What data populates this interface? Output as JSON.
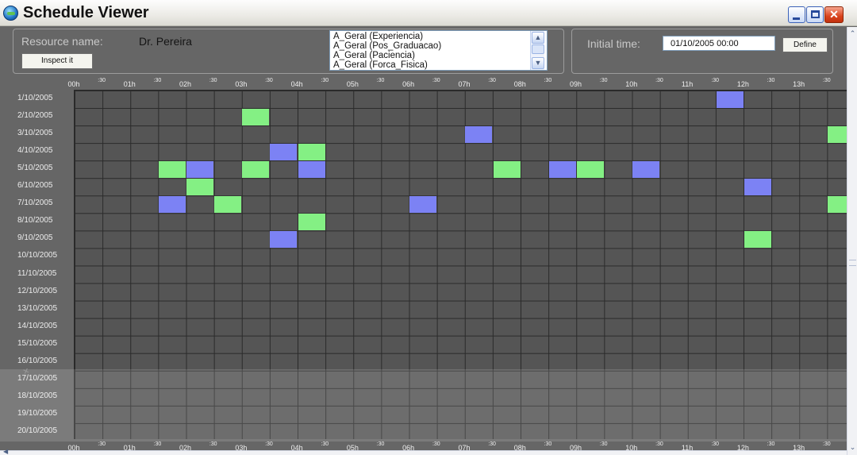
{
  "window": {
    "title": "Schedule Viewer",
    "minimize_glyph": "_",
    "close_glyph": "✕"
  },
  "resource": {
    "label": "Resource name:",
    "value": "Dr. Pereira",
    "inspect_button": "Inspect it"
  },
  "attributes": [
    "A_Geral (Experiencia)",
    "A_Geral (Pos_Graduacao)",
    "A_Geral (Paciencia)",
    "A_Geral (Forca_Fisica)"
  ],
  "initial_time": {
    "label": "Initial time:",
    "value": "01/10/2005 00:00",
    "define_button": "Define"
  },
  "hours": [
    "00h",
    "01h",
    "02h",
    "03h",
    "04h",
    "05h",
    "06h",
    "07h",
    "08h",
    "09h",
    "10h",
    "11h",
    "12h",
    "13h"
  ],
  "half_label": ":30",
  "dates": [
    "1/10/2005",
    "2/10/2005",
    "3/10/2005",
    "4/10/2005",
    "5/10/2005",
    "6/10/2005",
    "7/10/2005",
    "8/10/2005",
    "9/10/2005",
    "10/10/2005",
    "11/10/2005",
    "12/10/2005",
    "13/10/2005",
    "14/10/2005",
    "15/10/2005",
    "16/10/2005",
    "17/10/2005",
    "18/10/2005",
    "19/10/2005",
    "20/10/2005"
  ],
  "slot_colors": {
    "green": "#84f084",
    "blue": "#7c82f4",
    "empty": "#555555"
  },
  "slots": [
    {
      "date": 0,
      "slot": 23,
      "color": "blue"
    },
    {
      "date": 1,
      "slot": 6,
      "color": "green"
    },
    {
      "date": 2,
      "slot": 14,
      "color": "blue"
    },
    {
      "date": 2,
      "slot": 27,
      "color": "green"
    },
    {
      "date": 3,
      "slot": 7,
      "color": "blue"
    },
    {
      "date": 3,
      "slot": 8,
      "color": "green"
    },
    {
      "date": 4,
      "slot": 3,
      "color": "green"
    },
    {
      "date": 4,
      "slot": 4,
      "color": "blue"
    },
    {
      "date": 4,
      "slot": 6,
      "color": "green"
    },
    {
      "date": 4,
      "slot": 8,
      "color": "blue"
    },
    {
      "date": 4,
      "slot": 15,
      "color": "green"
    },
    {
      "date": 4,
      "slot": 17,
      "color": "blue"
    },
    {
      "date": 4,
      "slot": 18,
      "color": "green"
    },
    {
      "date": 4,
      "slot": 20,
      "color": "blue"
    },
    {
      "date": 5,
      "slot": 4,
      "color": "green"
    },
    {
      "date": 5,
      "slot": 24,
      "color": "blue"
    },
    {
      "date": 6,
      "slot": 3,
      "color": "blue"
    },
    {
      "date": 6,
      "slot": 5,
      "color": "green"
    },
    {
      "date": 6,
      "slot": 12,
      "color": "blue"
    },
    {
      "date": 6,
      "slot": 27,
      "color": "green"
    },
    {
      "date": 7,
      "slot": 8,
      "color": "green"
    },
    {
      "date": 8,
      "slot": 7,
      "color": "blue"
    },
    {
      "date": 8,
      "slot": 24,
      "color": "green"
    }
  ]
}
